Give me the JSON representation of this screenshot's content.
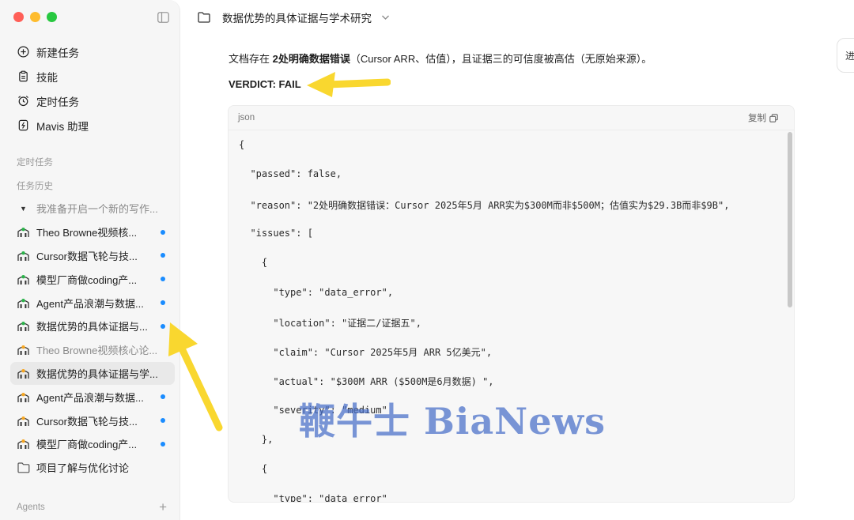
{
  "sidebar": {
    "menu": [
      {
        "label": "新建任务",
        "icon": "plus-circle-icon"
      },
      {
        "label": "技能",
        "icon": "clipboard-icon"
      },
      {
        "label": "定时任务",
        "icon": "alarm-clock-icon"
      },
      {
        "label": "Mavis 助理",
        "icon": "assistant-icon"
      }
    ],
    "scheduled_label": "定时任务",
    "history_label": "任务历史",
    "history": [
      {
        "label": "我准备开启一个新的写作...",
        "type": "group",
        "muted": true,
        "dot": false
      },
      {
        "label": "Theo Browne视频核...",
        "type": "green",
        "dot": true
      },
      {
        "label": "Cursor数据飞轮与技...",
        "type": "green",
        "dot": true
      },
      {
        "label": "模型厂商做coding产...",
        "type": "green",
        "dot": true
      },
      {
        "label": "Agent产品浪潮与数据...",
        "type": "green",
        "dot": true
      },
      {
        "label": "数据优势的具体证据与...",
        "type": "green",
        "dot": true
      },
      {
        "label": "Theo Browne视频核心论...",
        "type": "orange",
        "muted": true,
        "dot": false
      },
      {
        "label": "数据优势的具体证据与学...",
        "type": "orange",
        "active": true,
        "dot": false
      },
      {
        "label": "Agent产品浪潮与数据...",
        "type": "orange",
        "dot": true
      },
      {
        "label": "Cursor数据飞轮与技...",
        "type": "orange",
        "dot": true
      },
      {
        "label": "模型厂商做coding产...",
        "type": "orange",
        "dot": true
      },
      {
        "label": "项目了解与优化讨论",
        "type": "folder",
        "dot": false
      }
    ],
    "agents_label": "Agents"
  },
  "header": {
    "title": "数据优势的具体证据与学术研究"
  },
  "side_tab": "进",
  "content": {
    "summary_prefix": "文档存在 ",
    "summary_bold": "2处明确数据错误",
    "summary_suffix": "（Cursor ARR、估值），且证据三的可信度被高估（无原始来源）。",
    "verdict": "VERDICT: FAIL"
  },
  "code": {
    "language": "json",
    "copy_label": "复制",
    "lines": [
      "{",
      "  \"passed\": false,",
      "  \"reason\": \"2处明确数据错误：Cursor 2025年5月 ARR实为$300M而非$500M；估值实为$29.3B而非$9B\",",
      "  \"issues\": [",
      "    {",
      "      \"type\": \"data_error\",",
      "      \"location\": \"证据二/证据五\",",
      "      \"claim\": \"Cursor 2025年5月 ARR 5亿美元\",",
      "      \"actual\": \"$300M ARR ($500M是6月数据) \",",
      "      \"severity\": \"medium\"",
      "    },",
      "    {",
      "      \"type\": \"data_error\""
    ]
  },
  "watermark": "鞭牛士 BiaNews",
  "colors": {
    "accent_dot": "#1a8cff",
    "annotation_arrow": "#f9d72f",
    "watermark": "#466ec8"
  }
}
